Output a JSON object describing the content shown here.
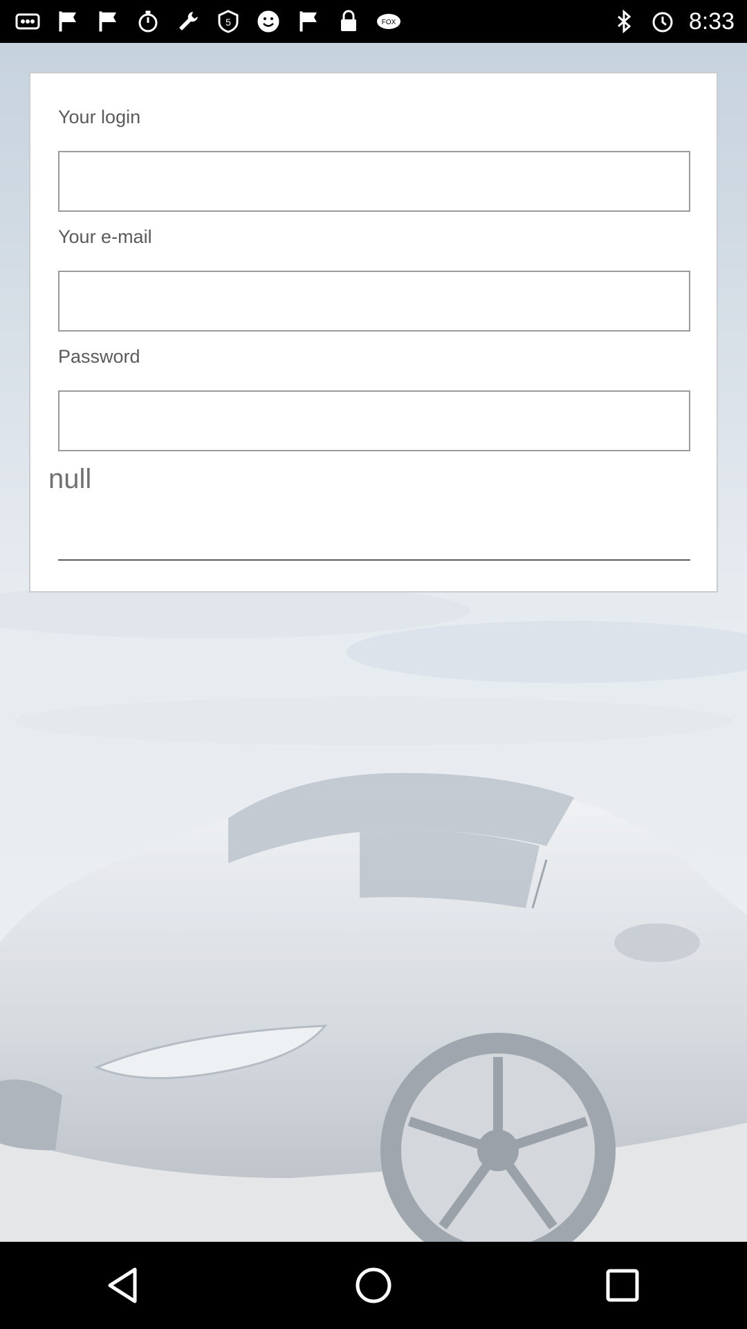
{
  "status_bar": {
    "time": "8:33",
    "left_icons": [
      "more-icon",
      "flag-icon",
      "flag-icon",
      "stopwatch-icon",
      "wrench-icon",
      "five-icon",
      "smiley-icon",
      "flag-icon",
      "lock-icon",
      "fox-sports-icon"
    ],
    "right_icons": [
      "bluetooth-icon",
      "alarm-icon"
    ]
  },
  "form": {
    "login_label": "Your login",
    "login_value": "",
    "email_label": "Your e-mail",
    "email_value": "",
    "password_label": "Password",
    "password_value": "",
    "null_label": "null",
    "extra_value": ""
  },
  "nav": {
    "back": "back-icon",
    "home": "home-icon",
    "recents": "recents-icon"
  }
}
